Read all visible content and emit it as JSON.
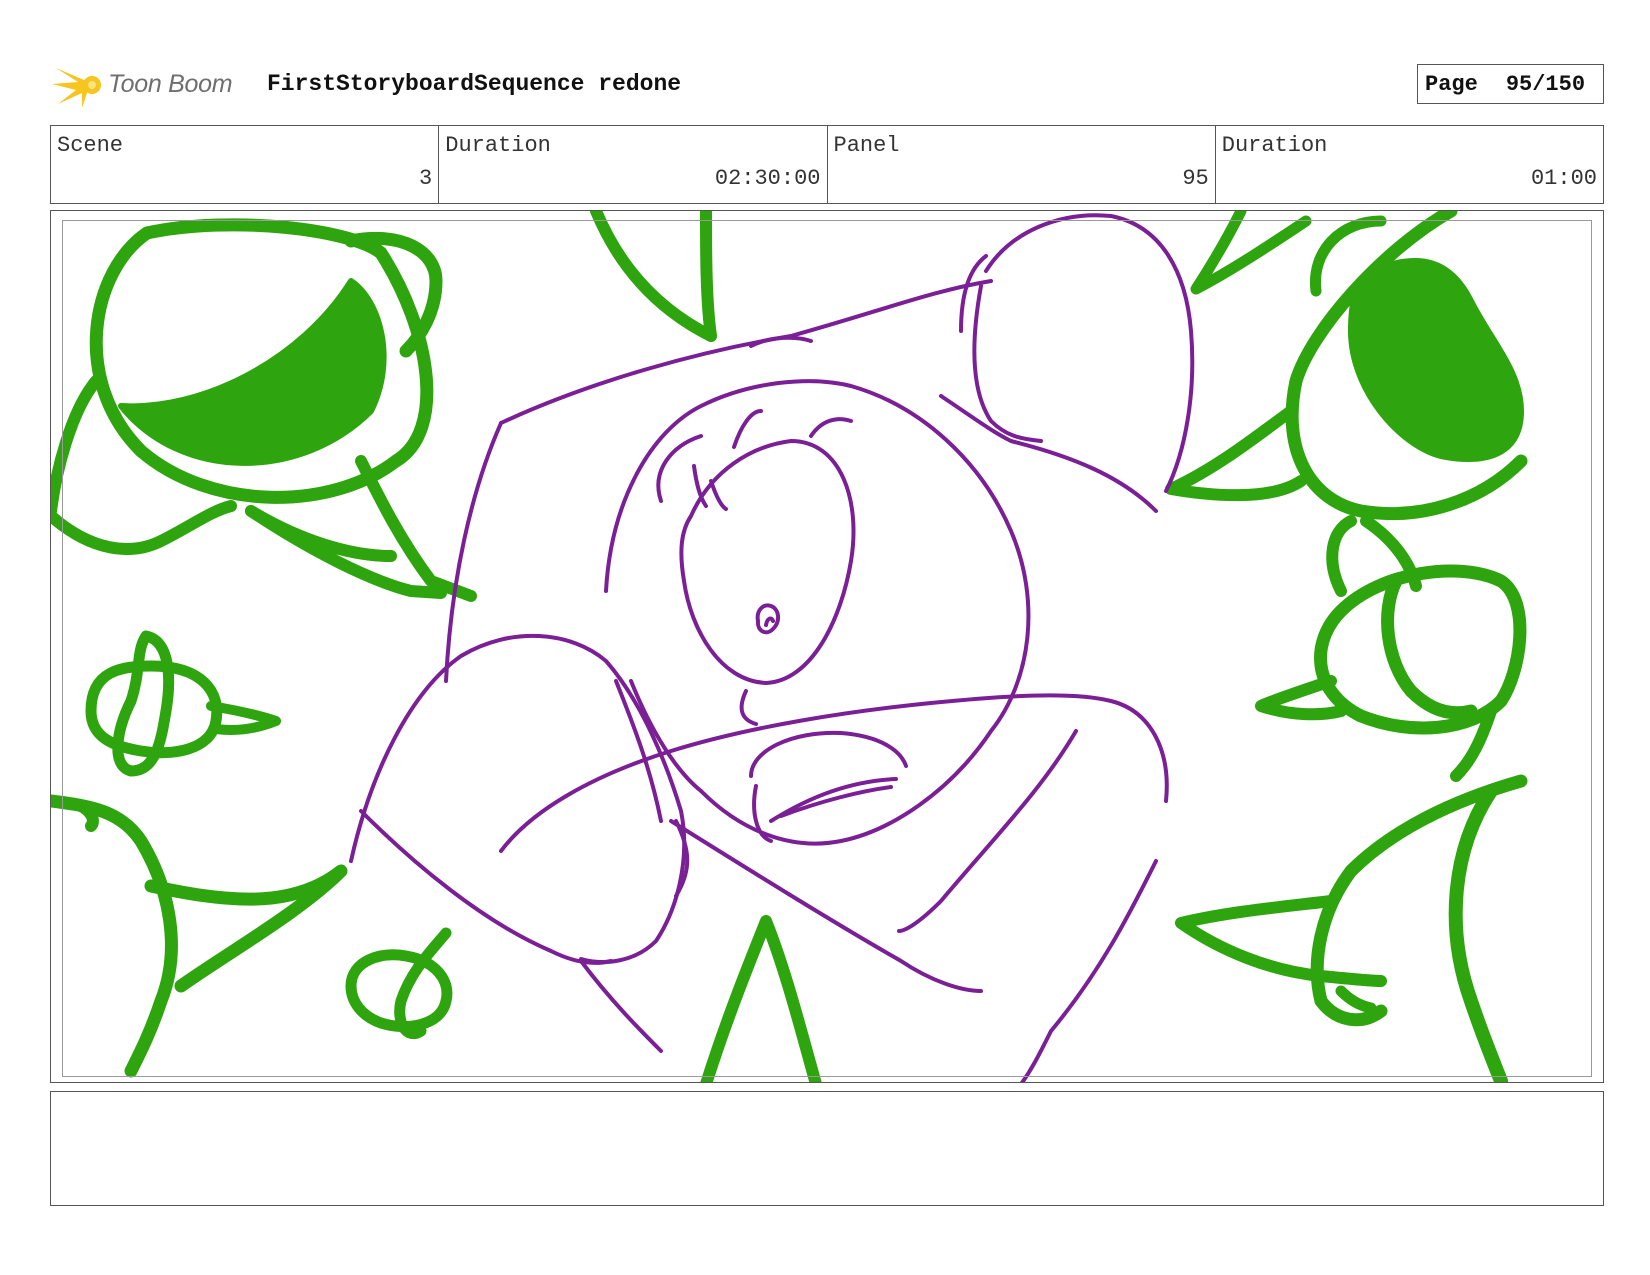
{
  "header": {
    "logo_text": "Toon Boom",
    "title": "FirstStoryboardSequence redone",
    "page_label": "Page",
    "page_value": "95/150"
  },
  "info": [
    {
      "label": "Scene",
      "value": "3"
    },
    {
      "label": "Duration",
      "value": "02:30:00"
    },
    {
      "label": "Panel",
      "value": "95"
    },
    {
      "label": "Duration",
      "value": "01:00"
    }
  ],
  "notes": {
    "text": ""
  },
  "colors": {
    "background_sketch": "#2ea40e",
    "character_sketch": "#7a1f96",
    "logo_star": "#f7c520",
    "border": "#555555"
  }
}
